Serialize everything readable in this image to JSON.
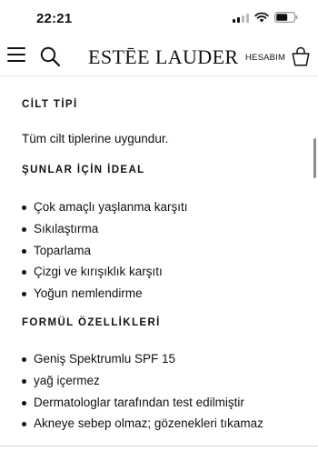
{
  "status": {
    "time": "22:21"
  },
  "header": {
    "brand": "ESTĒE LAUDER",
    "account_label": "HESABIM",
    "icons": [
      "menu-icon",
      "search-icon",
      "bag-icon"
    ]
  },
  "sections": {
    "skin_type": {
      "title": "CİLT TİPİ",
      "text": "Tüm cilt tiplerine uygundur."
    },
    "ideal_for": {
      "title": "ŞUNLAR İÇİN İDEAL",
      "items": [
        "Çok amaçlı yaşlanma karşıtı",
        "Sıkılaştırma",
        "Toparlama",
        "Çizgi ve kırışıklık karşıtı",
        "Yoğun nemlendirme"
      ]
    },
    "formula": {
      "title": "FORMÜL ÖZELLİKLERİ",
      "items": [
        "Geniş Spektrumlu SPF 15",
        "yağ içermez",
        "Dermatologlar tarafından test edilmiştir",
        "Akneye sebep olmaz; gözenekleri tıkamaz"
      ]
    }
  }
}
